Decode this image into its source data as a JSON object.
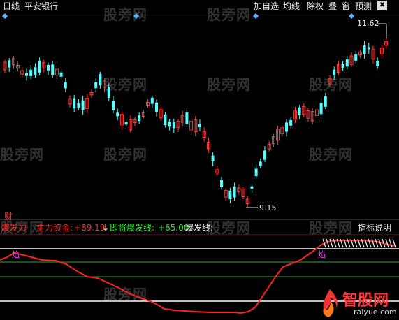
{
  "toolbar": {
    "period": "日线",
    "stock_name": "平安银行",
    "buttons": [
      "加自选",
      "均线",
      "除权",
      "叠",
      "窗",
      "预测"
    ],
    "close_symbol": "✖"
  },
  "price_labels": {
    "high": "11.62",
    "low": "9.15"
  },
  "lower_panel": {
    "cai_label": "财",
    "indicator_title": "爆发力",
    "main_fund_label": "主力资金:",
    "main_fund_value": "+89.19",
    "arrow": "↓",
    "imminent_label": "即将爆发线:",
    "imminent_value": "+65.00",
    "burst_label": "爆发线:",
    "help_button": "指标说明",
    "marker_left": "焰",
    "marker_right": "焰"
  },
  "watermarks": [
    "股旁网",
    "股旁网",
    "股旁网",
    "股旁网",
    "股旁网",
    "股旁网",
    "股旁网",
    "股旁网",
    "股旁网",
    "股旁网",
    "股旁网",
    "股旁网"
  ],
  "logo": {
    "cn": "智股网",
    "en": "raiyue.com"
  },
  "colors": {
    "up": "#ff3a3a",
    "down": "#54ffff",
    "red_line": "#ff2020",
    "green_line": "#2ea82e",
    "white_line": "#ffffff",
    "toolbar": "#000000"
  }
}
